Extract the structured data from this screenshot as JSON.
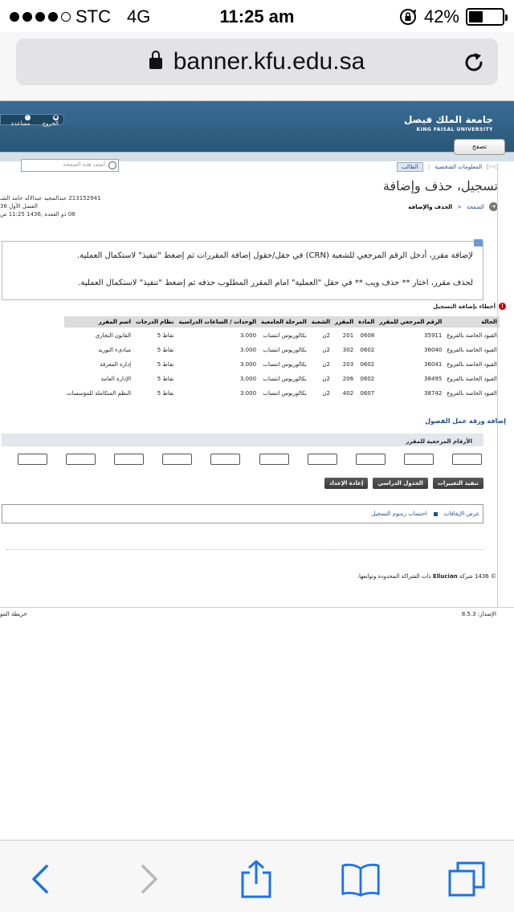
{
  "status_bar": {
    "carrier": "STC",
    "network": "4G",
    "time": "11:25 am",
    "battery": "42%",
    "battery_level": 0.42
  },
  "browser": {
    "url": "banner.kfu.edu.sa"
  },
  "header": {
    "university_ar": "جامعة الملك فيصل",
    "university_en": "KING FAISAL UNIVERSITY",
    "logout": "الخروج",
    "help": "مساعدة",
    "menu_button": "تصفح",
    "search_placeholder": "أضف هذه الصفحة"
  },
  "tabs": {
    "personal": "المعلومات الشخصية",
    "student": "الطالب"
  },
  "page_title": "تسجيل، حذف وإضافة",
  "user": {
    "line1": "213152941 عبدالمجيد عبدالاله حامد الشـ",
    "line2": "الفصل الأول 36",
    "line3": "08 ذو القعدة ,1436 11:25 ص"
  },
  "breadcrumb": {
    "home": "الصفحة",
    "current": "الحذف والإضافة"
  },
  "info": {
    "add_text": "لإضافة مقرر، أدخل الرقم المرجعي للشعبة (CRN) في حقل/حقول إضافة المقررات ثم إضغط \"تنفيذ\" لاستكمال العملية.",
    "drop_text": "لحذف مقرر، اختار ** حذف ويب ** في حقل \"العملية\" امام المقرر المطلوب حذفه ثم إضغط \"تنفيذ\" لاستكمال العملية."
  },
  "errors_title": "أخطاء بإضافة التسجيل",
  "table": {
    "headers": [
      "الحالة",
      "الرقم المرجعي للمقرر",
      "المادة",
      "المقرر",
      "الشعبة",
      "المرحلة الجامعية",
      "الوحدات / الساعات الدراسية",
      "نظام الدرجات",
      "اسم المقرر"
    ],
    "rows": [
      [
        "القيود الخاصة بالفروع",
        "35911",
        "0608",
        "201",
        "2ن",
        "بكالوريوس انتساب",
        "3.000",
        "نقاط 5",
        "القانون التجاري"
      ],
      [
        "القيود الخاصة بالفروع",
        "36040",
        "0602",
        "302",
        "2ن",
        "بكالوريوس انتساب",
        "3.000",
        "نقاط 5",
        "مبادىء التوريد"
      ],
      [
        "القيود الخاصة بالفروع",
        "36041",
        "0602",
        "203",
        "2ن",
        "بكالوريوس انتساب",
        "3.000",
        "نقاط 5",
        "إدارة المعرفة"
      ],
      [
        "القيود الخاصة بالفروع",
        "38495",
        "0602",
        "206",
        "2ن",
        "بكالوريوس انتساب",
        "3.000",
        "نقاط 5",
        "الإدارة العامة"
      ],
      [
        "القيود الخاصة بالفروع",
        "38742",
        "0607",
        "402",
        "2ن",
        "بكالوريوس انتساب",
        "3.000",
        "نقاط 5",
        "النظم المتكاملة للمؤسسات"
      ]
    ]
  },
  "worksheet": {
    "title": "إضافة ورقة عمل الفصول",
    "crn_label": "الأرقام المرجعية للمقرر"
  },
  "buttons": {
    "submit": "تنفيذ التغييرات",
    "schedule": "الجدول الدراسي",
    "reset": "إعادة الإعداد"
  },
  "links": {
    "holds": "عرض الإيقافات",
    "fees": "احتساب رسوم التسجيل"
  },
  "footer": {
    "copyright_prefix": "© 1436 شركة",
    "copyright_brand": "Ellucian",
    "copyright_suffix": "ذات الشراكة المحدودة وتوابعها.",
    "release": "الإصدار: 8.5.3",
    "sitemap": "خريطة المو"
  }
}
